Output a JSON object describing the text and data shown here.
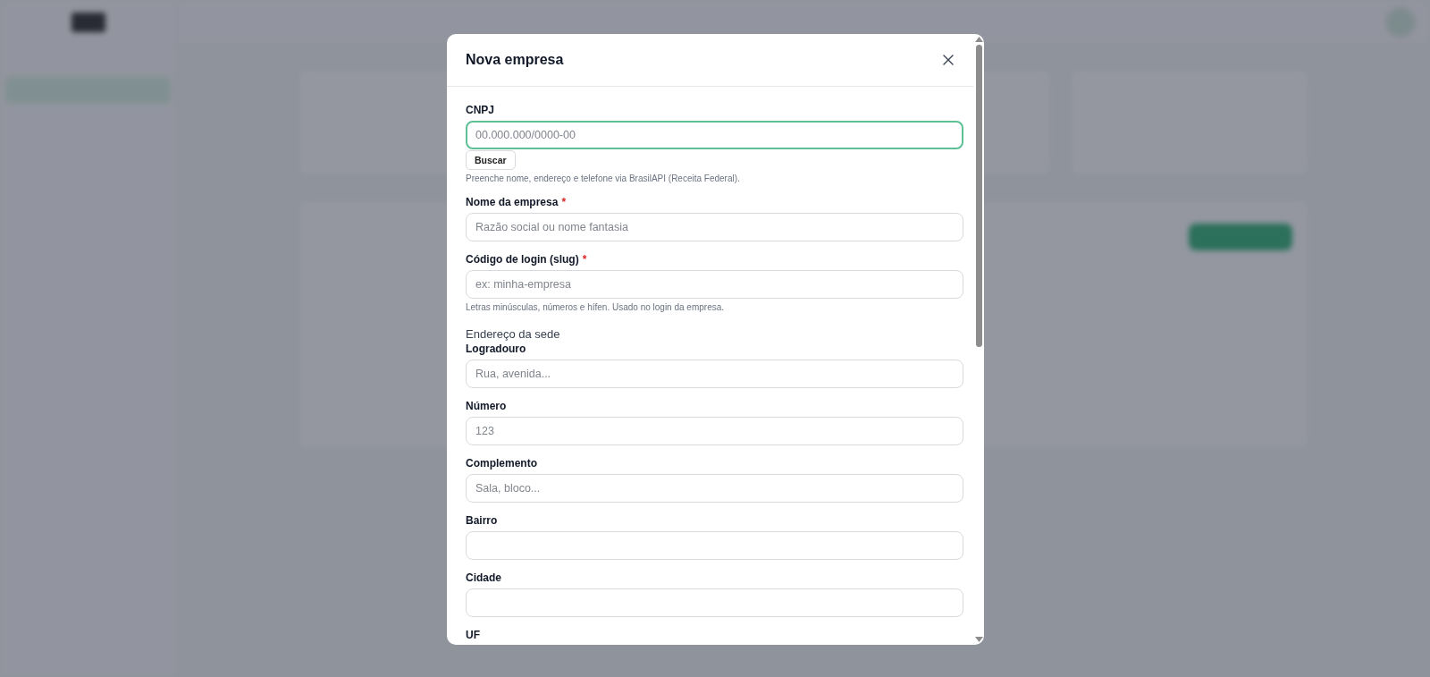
{
  "modal": {
    "title": "Nova empresa",
    "form": [
      {
        "kind": "field",
        "label": "CNPJ",
        "placeholder": "00.000.000/0000-00",
        "focused": true,
        "action": "Buscar",
        "hint": "Preenche nome, endereço e telefone via BrasilAPI (Receita Federal)."
      },
      {
        "kind": "field",
        "label": "Nome da empresa",
        "required_mark": "*",
        "placeholder": "Razão social ou nome fantasia",
        "focused": false
      },
      {
        "kind": "field",
        "label": "Código de login (slug)",
        "required_mark": "*",
        "placeholder": "ex: minha-empresa",
        "focused": false,
        "hint": "Letras minúsculas, números e hífen. Usado no login da empresa."
      },
      {
        "kind": "heading",
        "text": "Endereço da sede"
      },
      {
        "kind": "field",
        "label": "Logradouro",
        "placeholder": "Rua, avenida...",
        "focused": false
      },
      {
        "kind": "field",
        "label": "Número",
        "placeholder": "123",
        "focused": false
      },
      {
        "kind": "field",
        "label": "Complemento",
        "placeholder": "Sala, bloco...",
        "focused": false
      },
      {
        "kind": "field",
        "label": "Bairro",
        "focused": false
      },
      {
        "kind": "field",
        "label": "Cidade",
        "focused": false
      },
      {
        "kind": "label",
        "text": "UF"
      }
    ]
  }
}
